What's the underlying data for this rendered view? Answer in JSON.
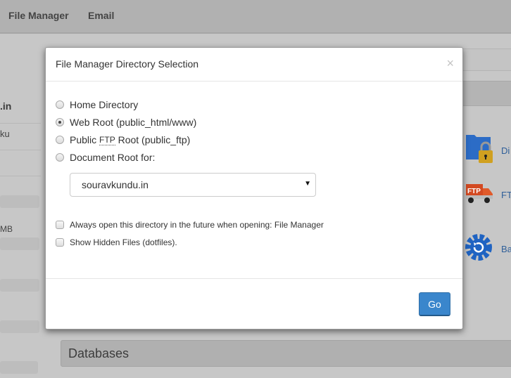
{
  "topbar": {
    "nav": [
      "File Manager",
      "Email"
    ]
  },
  "left_stats": {
    "domain_fragment": ".in",
    "user_fragment": "ku",
    "size_fragment": "MB"
  },
  "tools": [
    {
      "label": "Di",
      "icon": "folder-lock-icon"
    },
    {
      "label": "FT",
      "icon": "ftp-truck-icon"
    },
    {
      "label": "Ba",
      "icon": "backup-gear-icon"
    }
  ],
  "databases_panel": {
    "title": "Databases"
  },
  "modal": {
    "title": "File Manager  Directory Selection",
    "close_label": "×",
    "radios": [
      {
        "label": "Home Directory",
        "checked": false
      },
      {
        "label": "Web Root (public_html/www)",
        "checked": true
      },
      {
        "label_pre": "Public ",
        "label_abbr": "FTP",
        "label_post": " Root (public_ftp)",
        "checked": false
      },
      {
        "label": "Document Root for:",
        "checked": false
      }
    ],
    "domain_select": {
      "value": "souravkundu.in"
    },
    "checkboxes": [
      {
        "label": "Always open this directory in the future when opening: File Manager",
        "checked": false
      },
      {
        "label": "Show Hidden Files (dotfiles).",
        "checked": false
      }
    ],
    "go_label": "Go"
  },
  "colors": {
    "primary_button": "#3a86cc",
    "link": "#2f5f99"
  }
}
